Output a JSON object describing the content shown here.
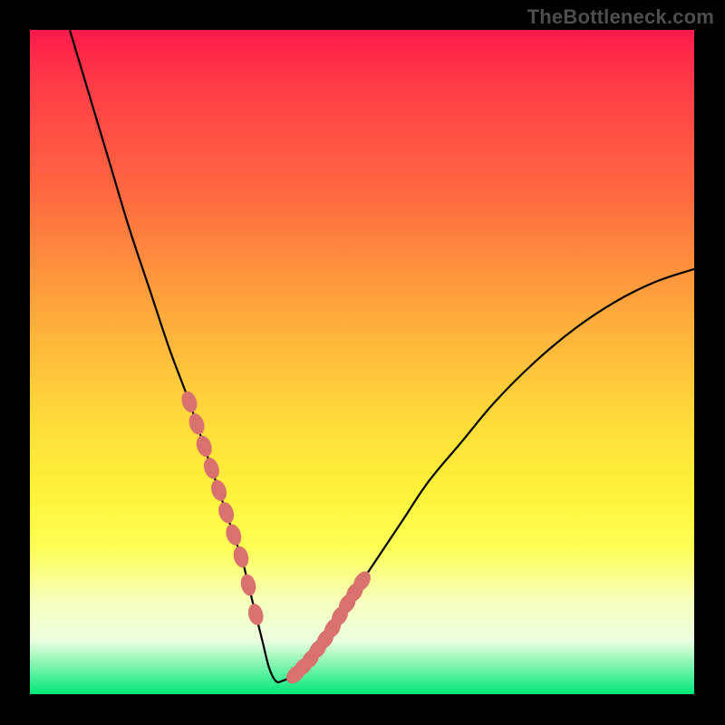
{
  "watermark": "TheBottleneck.com",
  "colors": {
    "curve_stroke": "#000000",
    "bead_fill": "#d9726f",
    "bead_stroke": "#c24f4c"
  },
  "chart_data": {
    "type": "line",
    "title": "",
    "xlabel": "",
    "ylabel": "",
    "xlim": [
      0,
      100
    ],
    "ylim": [
      0,
      100
    ],
    "series": [
      {
        "name": "bottleneck-curve",
        "x": [
          6,
          9,
          12,
          15,
          18,
          21,
          24,
          26,
          28,
          30,
          32,
          33,
          34,
          35,
          36,
          37,
          38,
          40,
          42,
          45,
          48,
          52,
          56,
          60,
          65,
          70,
          76,
          82,
          88,
          94,
          100
        ],
        "y": [
          100,
          90,
          80,
          70,
          61,
          52,
          44,
          38,
          32,
          26,
          20,
          16,
          12,
          8,
          4,
          2,
          2,
          3,
          5,
          9,
          14,
          20,
          26,
          32,
          38,
          44,
          50,
          55,
          59,
          62,
          64
        ]
      }
    ],
    "beads": {
      "left": {
        "x_range": [
          24,
          34
        ],
        "count": 10
      },
      "right": {
        "x_range": [
          40,
          50
        ],
        "count": 10
      }
    }
  }
}
